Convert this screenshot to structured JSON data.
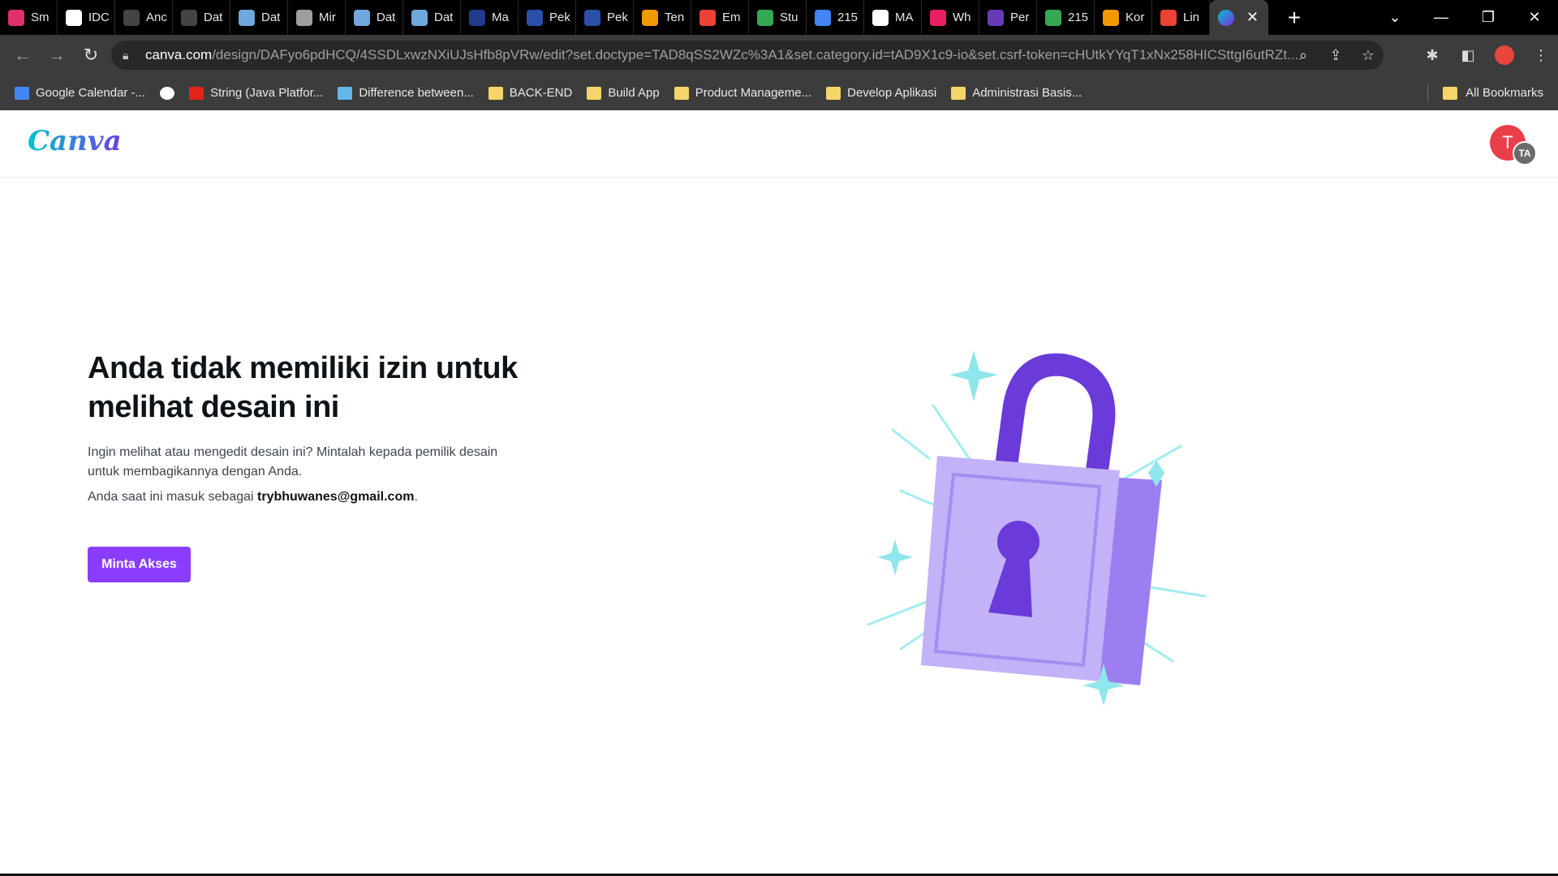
{
  "browser": {
    "tabs": [
      {
        "label": "Sm",
        "icon": "instagram-icon",
        "color": "#e1306c"
      },
      {
        "label": "IDC",
        "icon": "idcloudhost-icon",
        "color": "#ffffff"
      },
      {
        "label": "Anc",
        "icon": "g-icon",
        "color": "#444444"
      },
      {
        "label": "Dat",
        "icon": "g-icon",
        "color": "#444444"
      },
      {
        "label": "Dat",
        "icon": "dataset-icon",
        "color": "#6fa8dc"
      },
      {
        "label": "Mir",
        "icon": "globe-icon",
        "color": "#9e9e9e"
      },
      {
        "label": "Dat",
        "icon": "dataset-icon",
        "color": "#6fa8dc"
      },
      {
        "label": "Dat",
        "icon": "dataset-icon",
        "color": "#6fa8dc"
      },
      {
        "label": "Ma",
        "icon": "site-icon",
        "color": "#1f3b8a"
      },
      {
        "label": "Pek",
        "icon": "portal-icon",
        "color": "#2a4fa8"
      },
      {
        "label": "Pek",
        "icon": "portal-icon",
        "color": "#2a4fa8"
      },
      {
        "label": "Ten",
        "icon": "orange-q-icon",
        "color": "#f29900"
      },
      {
        "label": "Em",
        "icon": "gmail-icon",
        "color": "#ea4335"
      },
      {
        "label": "Stu",
        "icon": "google-drive-icon",
        "color": "#34a853"
      },
      {
        "label": "215",
        "icon": "google-docs-icon",
        "color": "#4285f4"
      },
      {
        "label": "MA",
        "icon": "google-icon",
        "color": "#ffffff"
      },
      {
        "label": "Wh",
        "icon": "colorful-icon",
        "color": "#e91e63"
      },
      {
        "label": "Per",
        "icon": "form-icon",
        "color": "#673ab7"
      },
      {
        "label": "215",
        "icon": "google-drive-icon",
        "color": "#34a853"
      },
      {
        "label": "Kor",
        "icon": "orange-q-icon",
        "color": "#f29900"
      },
      {
        "label": "Lin",
        "icon": "gmail-icon",
        "color": "#ea4335"
      }
    ],
    "active_tab": {
      "icon": "canva-icon",
      "close": "✕"
    },
    "new_tab": "+",
    "url_host": "canva.com",
    "url_rest": "/design/DAFyo6pdHCQ/4SSDLxwzNXiUJsHfb8pVRw/edit?set.doctype=TAD8qSS2WZc%3A1&set.category.id=tAD9X1c9-io&set.csrf-token=cHUtkYYqT1xNx258HICSttgI6utRZt...",
    "bookmarks": [
      {
        "label": "Google Calendar -...",
        "icon": "calendar-icon",
        "color": "#4285f4"
      },
      {
        "label": "",
        "icon": "globe-icon",
        "color": "#ffffff"
      },
      {
        "label": "String (Java Platfor...",
        "icon": "oracle-icon",
        "color": "#e2231a"
      },
      {
        "label": "Difference between...",
        "icon": "baeldung-icon",
        "color": "#63b8ea"
      },
      {
        "label": "BACK-END",
        "icon": "folder-icon",
        "color": "#f5d567"
      },
      {
        "label": "Build App",
        "icon": "folder-icon",
        "color": "#f5d567"
      },
      {
        "label": "Product Manageme...",
        "icon": "folder-icon",
        "color": "#f5d567"
      },
      {
        "label": "Develop Aplikasi",
        "icon": "folder-icon",
        "color": "#f5d567"
      },
      {
        "label": "Administrasi Basis...",
        "icon": "folder-icon",
        "color": "#f5d567"
      }
    ],
    "all_bookmarks": "All Bookmarks"
  },
  "canva": {
    "logo": "Canva",
    "avatar_initial": "T",
    "avatar_badge": "TA",
    "title": "Anda tidak memiliki izin untuk melihat desain ini",
    "description": "Ingin melihat atau mengedit desain ini? Mintalah kepada pemilik desain untuk membagikannya dengan Anda.",
    "signed_in_prefix": "Anda saat ini masuk sebagai ",
    "signed_in_email": "trybhuwanes@gmail.com",
    "signed_in_suffix": ".",
    "button_label": "Minta Akses",
    "accent": "#8b3dff"
  }
}
